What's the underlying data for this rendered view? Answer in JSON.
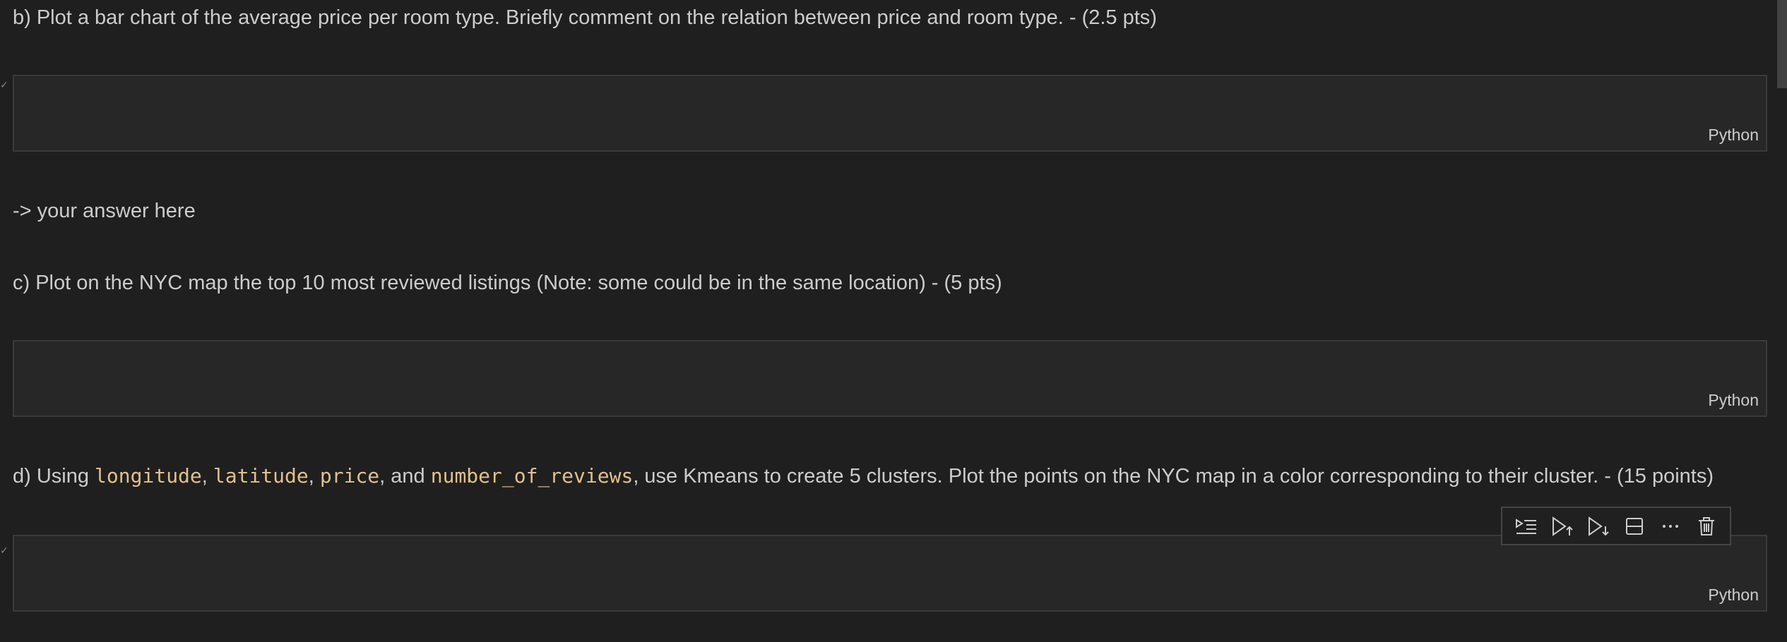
{
  "cells": {
    "b_prompt": "b) Plot a bar chart of the average price per room type. Briefly comment on the relation between price and room type. - (2.5 pts)",
    "answer": "-> your answer here",
    "c_prompt": "c) Plot on the NYC map the top 10 most reviewed listings (Note: some could be in the same location) - (5 pts)",
    "d_prompt": {
      "prefix": "d) Using ",
      "code1": "longitude",
      "sep1": ", ",
      "code2": "latitude",
      "sep2": ", ",
      "code3": "price",
      "sep3": ", and ",
      "code4": "number_of_reviews",
      "suffix": ", use Kmeans to create 5 clusters. Plot the points on the NYC map in a color corresponding to their cluster. - (15 points)"
    },
    "code_lang": "Python"
  },
  "toolbar": {
    "icons": [
      "run-by-line-icon",
      "execute-above-icon",
      "execute-below-icon",
      "split-cell-icon",
      "more-icon",
      "delete-icon"
    ]
  },
  "colors": {
    "background": "#1f1f1f",
    "cell_bg": "#272727",
    "text": "#cccccc",
    "inline_code": "#e2c08d"
  }
}
